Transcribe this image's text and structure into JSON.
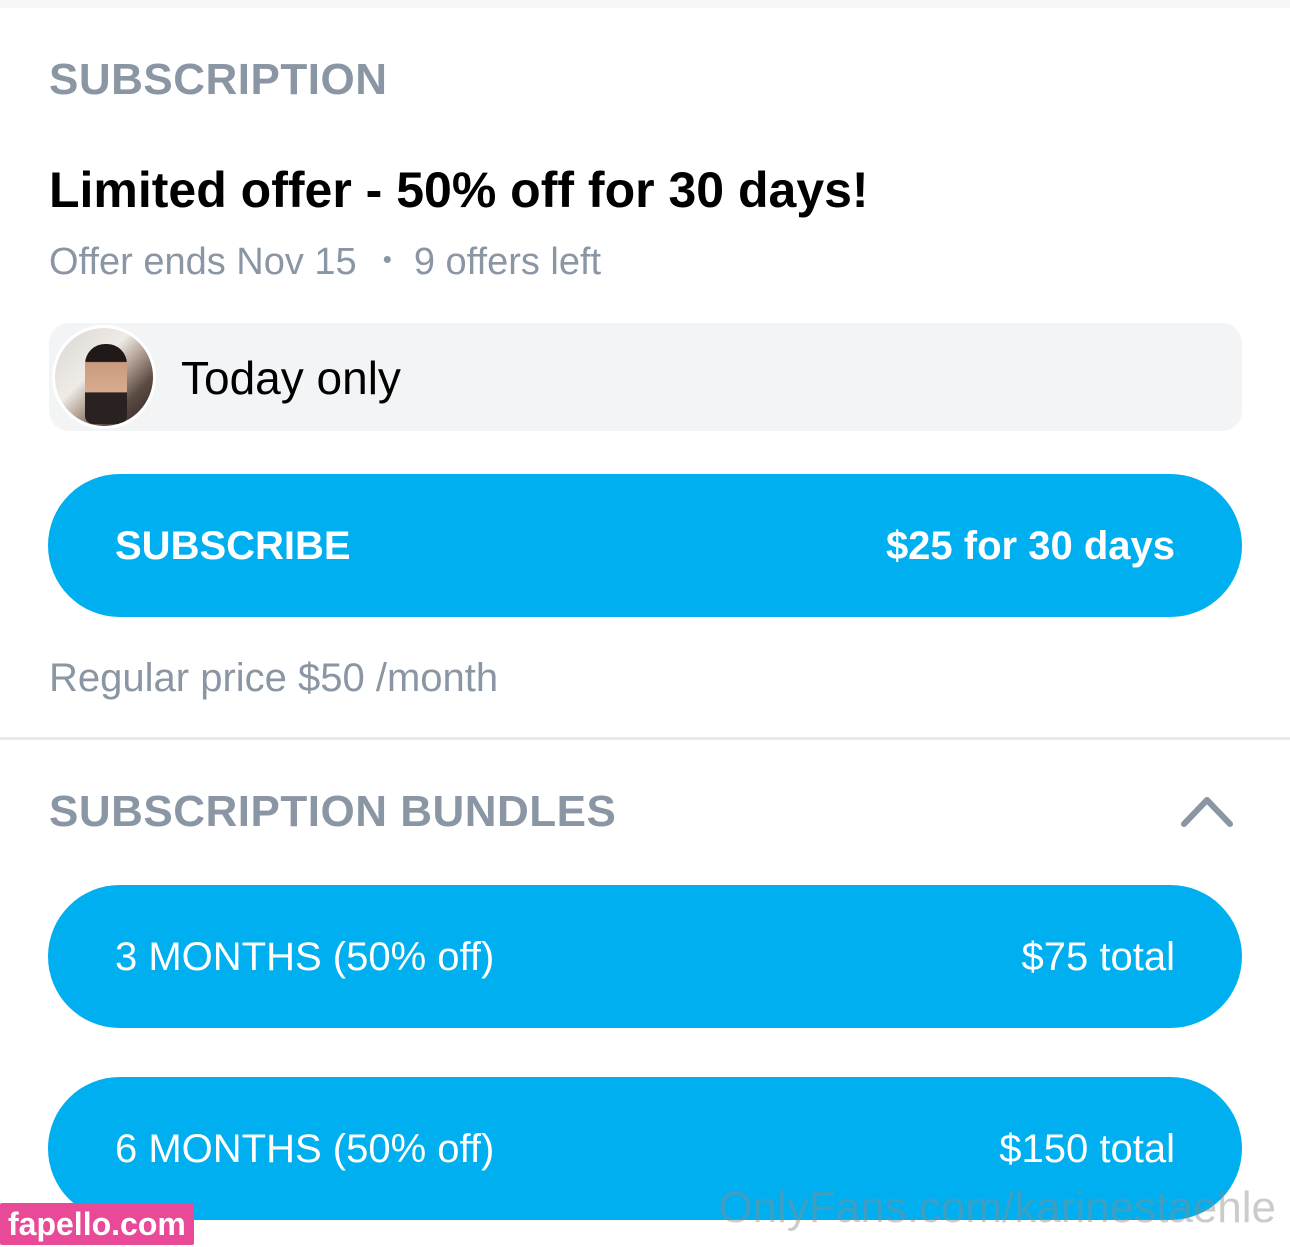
{
  "subscription": {
    "section_title": "SUBSCRIPTION",
    "offer_title": "Limited offer - 50% off for 30 days!",
    "offer_ends": "Offer ends Nov 15",
    "separator": "•",
    "offers_left": "9 offers left",
    "message": "Today only",
    "subscribe_button": {
      "label": "SUBSCRIBE",
      "price": "$25 for 30 days"
    },
    "regular_price": "Regular price $50 /month"
  },
  "bundles": {
    "section_title": "SUBSCRIPTION BUNDLES",
    "toggle_icon": "chevron-up-icon",
    "items": [
      {
        "label": "3 MONTHS (50% off)",
        "price": "$75 total"
      },
      {
        "label": "6 MONTHS (50% off)",
        "price": "$150 total"
      }
    ]
  },
  "watermarks": {
    "left": "fapello.com",
    "right": "OnlyFans.com/karinestaehle"
  },
  "colors": {
    "accent": "#00aff0",
    "muted_text": "#8a96a3",
    "primary_text": "#000000",
    "message_bg": "#f2f4f6",
    "watermark_pink": "#e94a97"
  }
}
